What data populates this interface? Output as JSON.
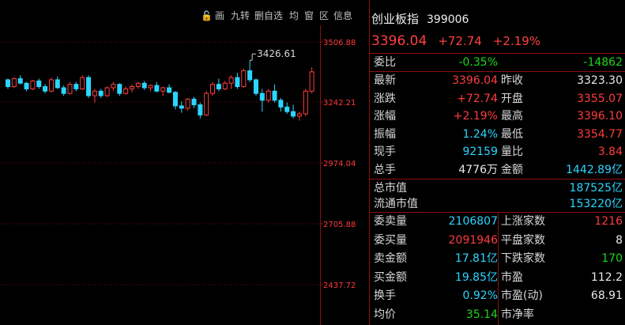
{
  "toolbar": {
    "items": [
      "画",
      "九转",
      "删自选",
      "均",
      "窗",
      "区",
      "信息"
    ]
  },
  "chart_data": {
    "type": "candlestick",
    "y_ticks": [
      "3506.88",
      "3242.21",
      "2974.04",
      "2705.88",
      "2437.72"
    ],
    "ylim": [
      2437.72,
      3506.88
    ],
    "annotation": "3426.61",
    "up_color": "#ff3c3c",
    "down_color": "#2ad6ff",
    "candles": [
      [
        3340,
        3345,
        3300,
        3310
      ],
      [
        3310,
        3350,
        3305,
        3345
      ],
      [
        3345,
        3360,
        3320,
        3325
      ],
      [
        3325,
        3330,
        3290,
        3300
      ],
      [
        3300,
        3340,
        3295,
        3335
      ],
      [
        3335,
        3345,
        3300,
        3310
      ],
      [
        3310,
        3320,
        3280,
        3290
      ],
      [
        3290,
        3350,
        3285,
        3340
      ],
      [
        3340,
        3355,
        3300,
        3305
      ],
      [
        3305,
        3315,
        3270,
        3280
      ],
      [
        3280,
        3330,
        3275,
        3320
      ],
      [
        3320,
        3330,
        3290,
        3300
      ],
      [
        3300,
        3360,
        3295,
        3350
      ],
      [
        3350,
        3360,
        3260,
        3270
      ],
      [
        3270,
        3300,
        3240,
        3290
      ],
      [
        3290,
        3300,
        3260,
        3270
      ],
      [
        3270,
        3310,
        3265,
        3305
      ],
      [
        3305,
        3330,
        3290,
        3320
      ],
      [
        3320,
        3325,
        3270,
        3280
      ],
      [
        3280,
        3310,
        3275,
        3300
      ],
      [
        3300,
        3320,
        3285,
        3310
      ],
      [
        3310,
        3330,
        3300,
        3325
      ],
      [
        3325,
        3335,
        3295,
        3305
      ],
      [
        3305,
        3320,
        3290,
        3315
      ],
      [
        3315,
        3330,
        3285,
        3290
      ],
      [
        3290,
        3310,
        3270,
        3305
      ],
      [
        3305,
        3320,
        3280,
        3285
      ],
      [
        3285,
        3290,
        3210,
        3225
      ],
      [
        3225,
        3245,
        3195,
        3215
      ],
      [
        3215,
        3260,
        3205,
        3255
      ],
      [
        3255,
        3265,
        3215,
        3230
      ],
      [
        3230,
        3240,
        3170,
        3185
      ],
      [
        3185,
        3290,
        3180,
        3280
      ],
      [
        3280,
        3330,
        3270,
        3320
      ],
      [
        3320,
        3345,
        3290,
        3300
      ],
      [
        3300,
        3335,
        3295,
        3325
      ],
      [
        3325,
        3360,
        3300,
        3350
      ],
      [
        3350,
        3370,
        3300,
        3310
      ],
      [
        3310,
        3390,
        3305,
        3380
      ],
      [
        3380,
        3426,
        3330,
        3340
      ],
      [
        3340,
        3345,
        3270,
        3280
      ],
      [
        3280,
        3300,
        3200,
        3250
      ],
      [
        3250,
        3300,
        3240,
        3290
      ],
      [
        3290,
        3320,
        3240,
        3250
      ],
      [
        3250,
        3260,
        3200,
        3220
      ],
      [
        3220,
        3240,
        3190,
        3200
      ],
      [
        3200,
        3230,
        3170,
        3180
      ],
      [
        3180,
        3200,
        3160,
        3190
      ],
      [
        3190,
        3300,
        3180,
        3290
      ],
      [
        3290,
        3395,
        3280,
        3375
      ]
    ]
  },
  "panel": {
    "name": "创业板指",
    "code": "399006",
    "price": "3396.04",
    "change": "+72.74",
    "pct": "+2.19%",
    "wb_label": "委比",
    "wb_pct": "-0.35%",
    "wb_diff": "-14862",
    "quote_rows": [
      {
        "l1": "最新",
        "v1": "3396.04",
        "c1": "red",
        "l2": "昨收",
        "v2": "3323.30",
        "c2": "white"
      },
      {
        "l1": "涨跌",
        "v1": "+72.74",
        "c1": "red",
        "l2": "开盘",
        "v2": "3355.07",
        "c2": "red"
      },
      {
        "l1": "涨幅",
        "v1": "+2.19%",
        "c1": "red",
        "l2": "最高",
        "v2": "3396.10",
        "c2": "red"
      },
      {
        "l1": "振幅",
        "v1": "1.24%",
        "c1": "cyan",
        "l2": "最低",
        "v2": "3354.77",
        "c2": "red"
      },
      {
        "l1": "现手",
        "v1": "92159",
        "c1": "cyan",
        "l2": "量比",
        "v2": "3.84",
        "c2": "red"
      },
      {
        "l1": "总手",
        "v1": "4776万",
        "c1": "white",
        "l2": "金额",
        "v2": "1442.89亿",
        "c2": "cyan"
      }
    ],
    "cap_rows": [
      {
        "l": "总市值",
        "v": "187525亿"
      },
      {
        "l": "流通市值",
        "v": "153220亿"
      }
    ],
    "order_rows": [
      {
        "l1": "委卖量",
        "v1": "2106807",
        "c1": "cyan",
        "l2": "上涨家数",
        "v2": "1216",
        "c2": "red"
      },
      {
        "l1": "委买量",
        "v1": "2091946",
        "c1": "red",
        "l2": "平盘家数",
        "v2": "8",
        "c2": "white"
      },
      {
        "l1": "卖金额",
        "v1": "17.81亿",
        "c1": "cyan",
        "l2": "下跌家数",
        "v2": "170",
        "c2": "green"
      },
      {
        "l1": "买金额",
        "v1": "19.85亿",
        "c1": "cyan",
        "l2": "市盈",
        "v2": "112.2",
        "c2": "white"
      },
      {
        "l1": "换手",
        "v1": "0.92%",
        "c1": "cyan",
        "l2": "市盈(动)",
        "v2": "68.91",
        "c2": "white"
      },
      {
        "l1": "均价",
        "v1": "35.14",
        "c1": "green",
        "l2": "市净率",
        "v2": "",
        "c2": "white"
      }
    ]
  }
}
